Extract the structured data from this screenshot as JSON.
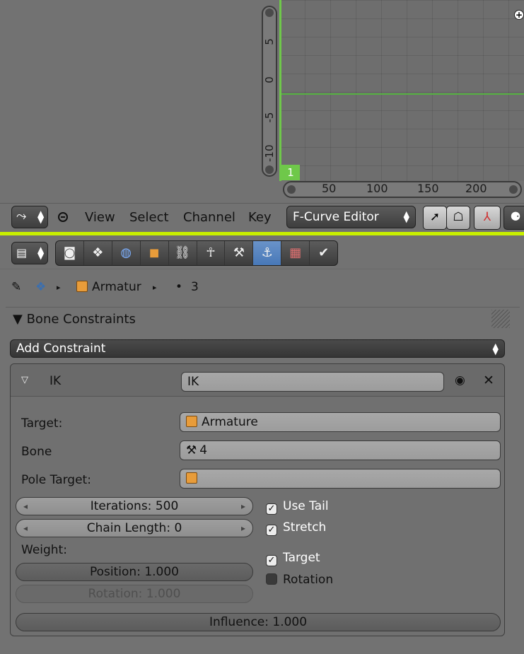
{
  "graph": {
    "y_ticks": [
      "5",
      "0",
      "-5",
      "-10"
    ],
    "x_ticks": [
      "50",
      "100",
      "150",
      "200"
    ],
    "current_frame": "1"
  },
  "header": {
    "menus": [
      "View",
      "Select",
      "Channel",
      "Key"
    ],
    "mode_select": "F-Curve Editor"
  },
  "properties": {
    "tabs": [
      "render",
      "render-layers",
      "world",
      "object",
      "constraints",
      "object-data",
      "bone",
      "bone-constraints",
      "texture",
      "modifiers"
    ],
    "active_tab": "bone-constraints",
    "breadcrumb": {
      "object": "Armatur",
      "bone": "3"
    }
  },
  "panel": {
    "title": "Bone Constraints",
    "add_constraint": "Add Constraint",
    "constraint": {
      "type_label": "IK",
      "name": "IK",
      "target_label": "Target:",
      "target_value": "Armature",
      "bone_label": "Bone",
      "bone_value": "4",
      "pole_target_label": "Pole Target:",
      "pole_target_value": "",
      "iterations": "Iterations: 500",
      "chain_length": "Chain Length: 0",
      "use_tail": "Use Tail",
      "stretch": "Stretch",
      "weight_label": "Weight:",
      "position": "Position: 1.000",
      "rotation_weight": "Rotation: 1.000",
      "target_check": "Target",
      "rotation_check": "Rotation",
      "influence": "Influence: 1.000"
    }
  },
  "colors": {
    "green_curve": "#6fc84a",
    "separator": "#c8f000",
    "active_tab": "#5585c2"
  }
}
